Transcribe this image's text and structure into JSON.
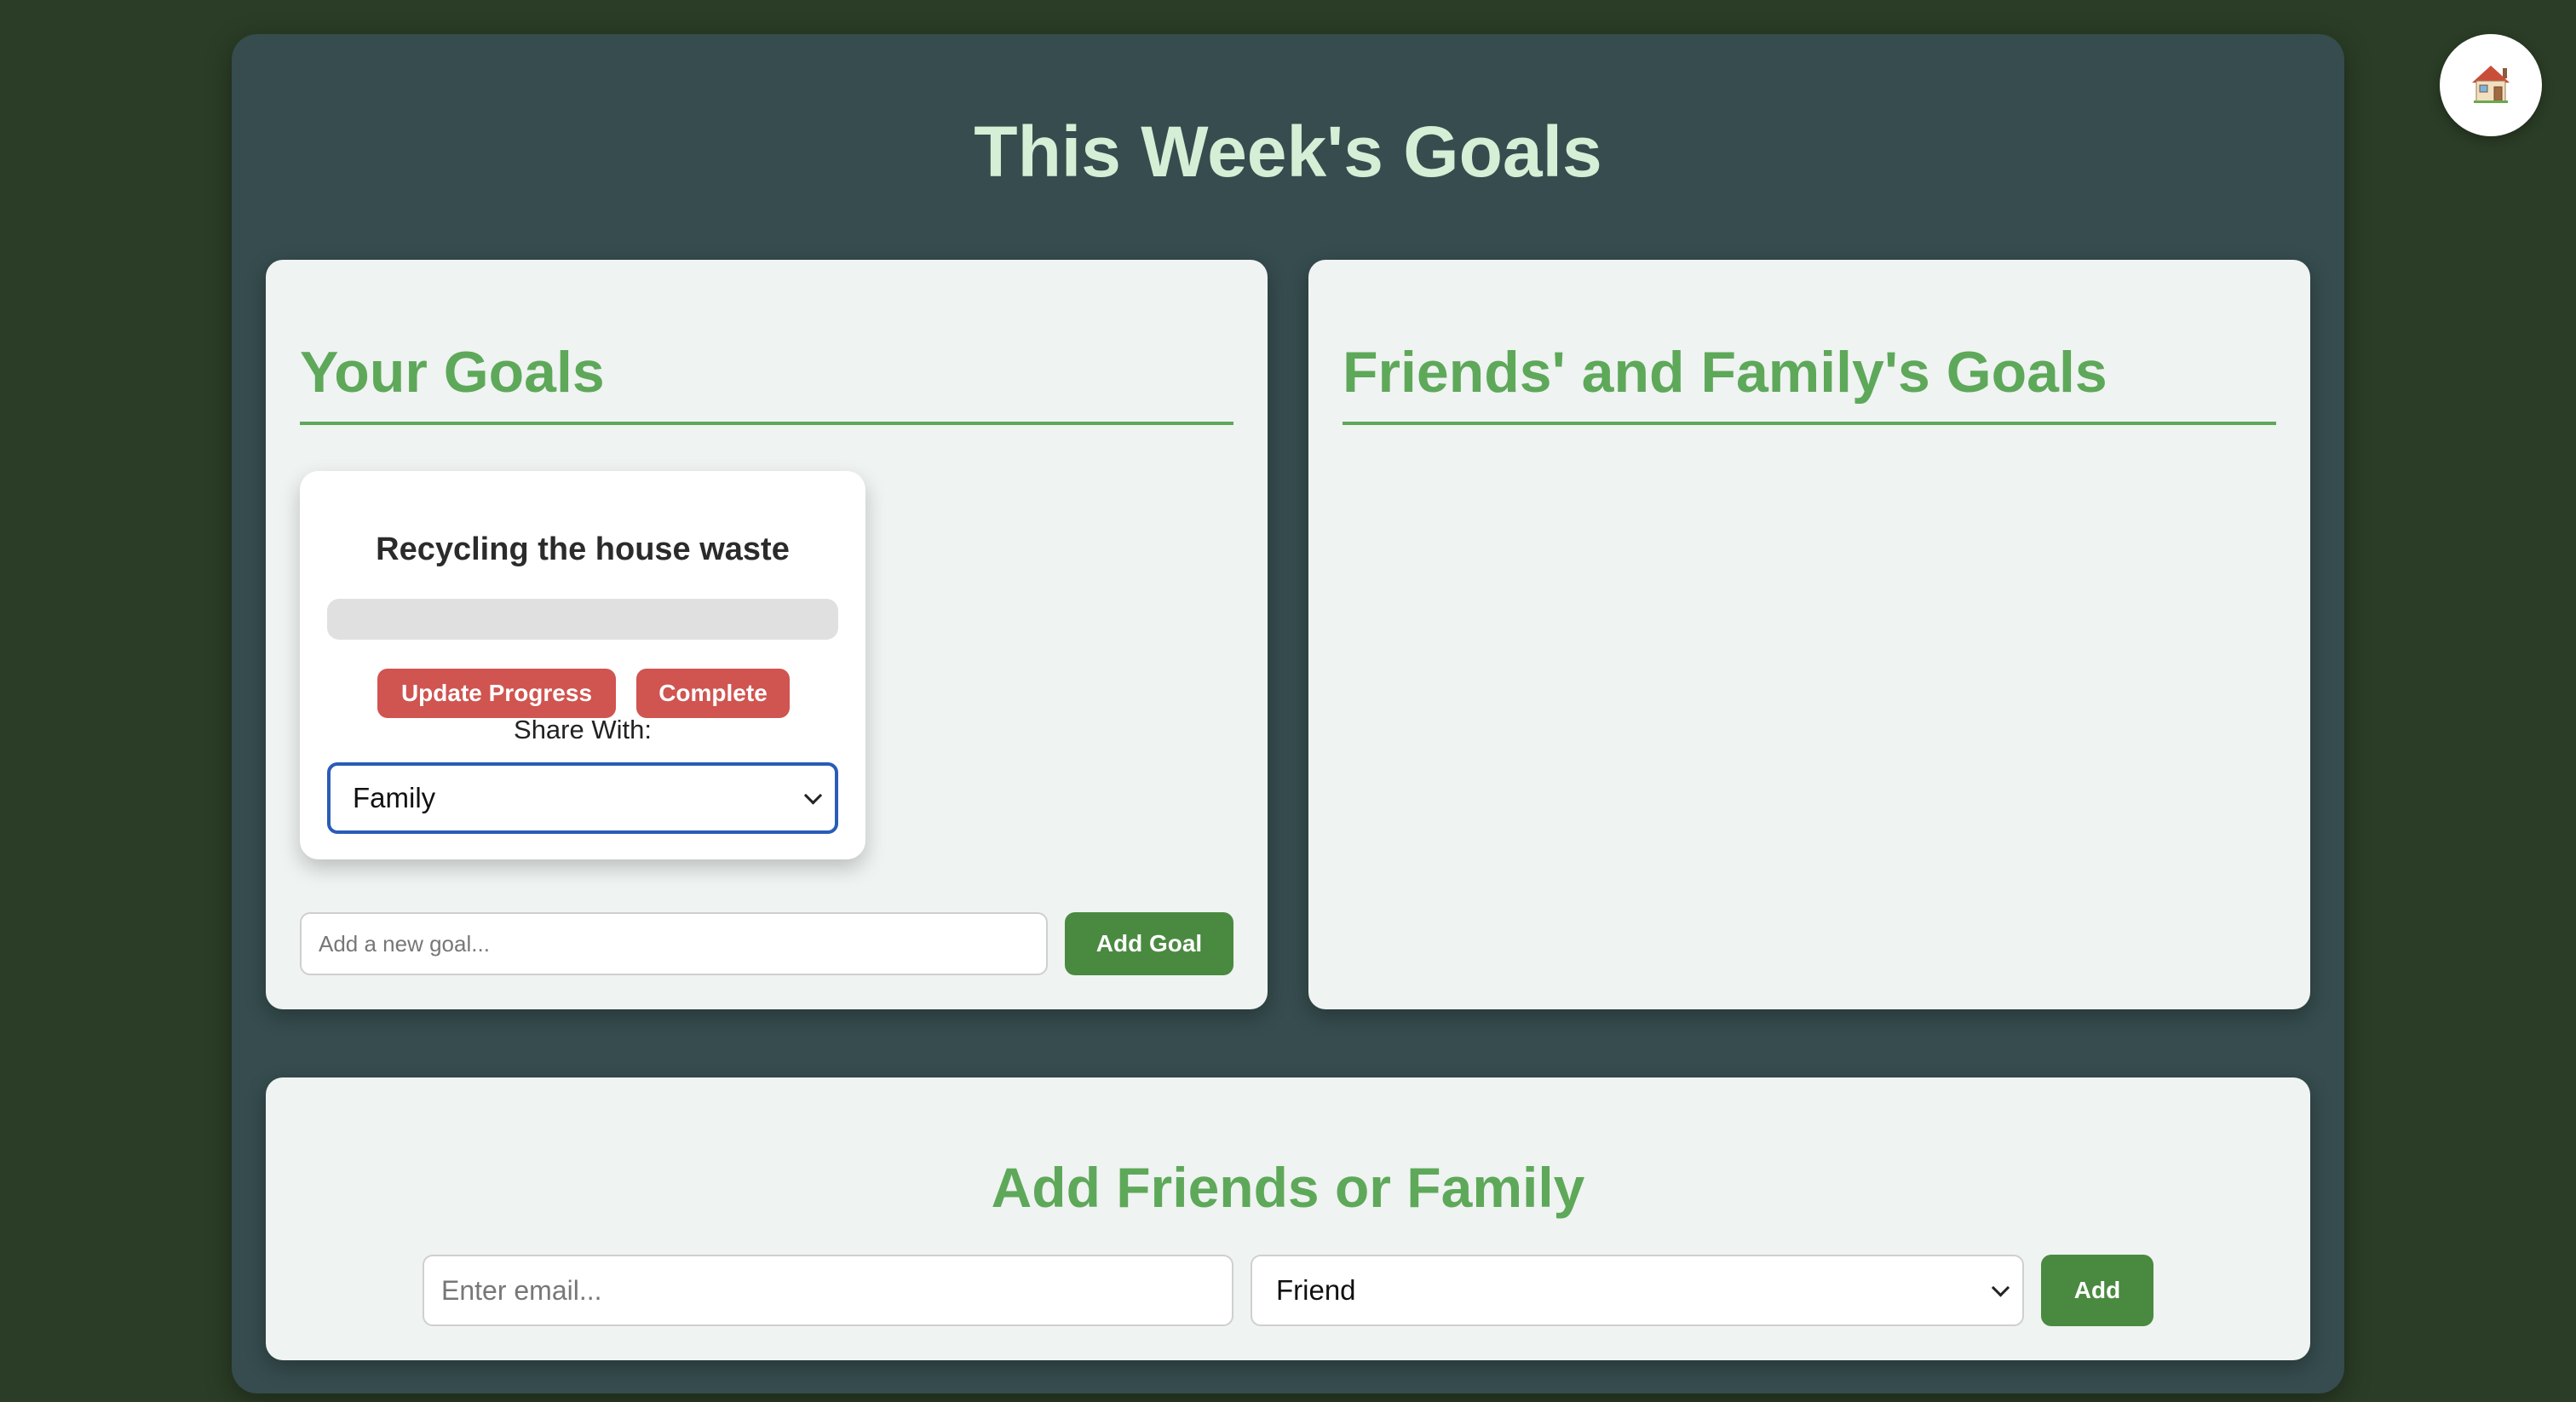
{
  "page": {
    "title": "This Week's Goals"
  },
  "home_button": {
    "icon": "house-icon"
  },
  "your_goals": {
    "heading": "Your Goals",
    "goals": [
      {
        "title": "Recycling the house waste",
        "progress": 0,
        "update_label": "Update Progress",
        "complete_label": "Complete",
        "share_label": "Share With:",
        "share_value": "Family"
      }
    ],
    "new_goal_placeholder": "Add a new goal...",
    "add_goal_label": "Add Goal"
  },
  "friends_goals": {
    "heading": "Friends' and Family's Goals"
  },
  "add_friends": {
    "heading": "Add Friends or Family",
    "email_placeholder": "Enter email...",
    "relation_value": "Friend",
    "add_label": "Add"
  },
  "colors": {
    "page_background": "#2b3d26",
    "panel_background": "#364c4e",
    "card_background": "#eff3f1",
    "title_text": "#d5eed6",
    "heading_green": "#5ea85a",
    "button_green": "#4a8a40",
    "button_red": "#d05450",
    "focus_blue": "#2a5cb8"
  }
}
